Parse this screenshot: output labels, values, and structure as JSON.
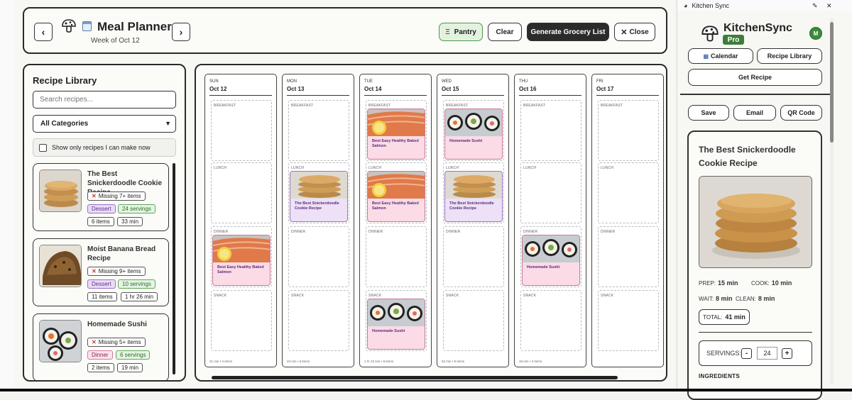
{
  "header": {
    "title": "Meal Planner",
    "week": "Week of Oct 12",
    "prev": "‹",
    "next": "›",
    "pantry": "Pantry",
    "clear": "Clear",
    "grocery": "Generate Grocery List",
    "close": "Close"
  },
  "library": {
    "title": "Recipe Library",
    "search_placeholder": "Search recipes...",
    "category": "All Categories",
    "only_label": "Show only recipes I can make now",
    "cards": [
      {
        "name": "The Best Snickerdoodle Cookie Recipe",
        "missing": "Missing 7+ items",
        "category": "Dessert",
        "servings": "24 servings",
        "items": "6 items",
        "time": "33 min"
      },
      {
        "name": "Moist Banana Bread Recipe",
        "missing": "Missing 9+ items",
        "category": "Dessert",
        "servings": "10 servings",
        "items": "11 items",
        "time": "1 hr 26 min"
      },
      {
        "name": "Homemade Sushi",
        "missing": "Missing 5+ items",
        "category": "Dinner",
        "servings": "6 servings",
        "items": "2 items",
        "time": "19 min"
      }
    ]
  },
  "calendar": {
    "slots": [
      "BREAKFAST",
      "LUNCH",
      "DINNER",
      "SNACK"
    ],
    "days": [
      {
        "name": "SUN",
        "date": "Oct 12",
        "footer": "31 min • 4 items",
        "meals": {
          "dinner": "Best Easy Healthy Baked Salmon"
        }
      },
      {
        "name": "MON",
        "date": "Oct 13",
        "footer": "33 min • 6 items",
        "meals": {
          "lunch": "The Best Snickerdoodle Cookie Recipe"
        }
      },
      {
        "name": "TUE",
        "date": "Oct 14",
        "footer": "1 hr 23 min • 8 items",
        "meals": {
          "breakfast": "Best Easy Healthy Baked Salmon",
          "lunch": "Best Easy Healthy Baked Salmon",
          "snack": "Homemade Sushi"
        }
      },
      {
        "name": "WED",
        "date": "Oct 15",
        "footer": "52 min • 8 items",
        "meals": {
          "breakfast": "Homemade Sushi",
          "lunch": "The Best Snickerdoodle Cookie Recipe"
        }
      },
      {
        "name": "THU",
        "date": "Oct 16",
        "footer": "19 min • 2 items",
        "meals": {
          "dinner": "Homemade Sushi"
        }
      },
      {
        "name": "FRI",
        "date": "Oct 17",
        "footer": "",
        "meals": {}
      }
    ]
  },
  "side": {
    "window_title": "Kitchen Sync",
    "brand": "KitchenSync",
    "pro": "Pro",
    "avatar": "M",
    "calendar_btn": "Calendar",
    "library_btn": "Recipe Library",
    "get_recipe": "Get Recipe",
    "save": "Save",
    "email": "Email",
    "qr": "QR Code",
    "recipe_title": "The Best Snickerdoodle Cookie Recipe",
    "prep_label": "PREP:",
    "prep": "15 min",
    "cook_label": "COOK:",
    "cook": "10 min",
    "wait_label": "WAIT:",
    "wait": "8 min",
    "clean_label": "CLEAN:",
    "clean": "8 min",
    "total_label": "TOTAL:",
    "total": "41 min",
    "servings_label": "SERVINGS:",
    "servings": "24",
    "minus": "-",
    "plus": "+",
    "ingredients": "INGREDIENTS"
  },
  "colors": {
    "pro": "#3d7d3a",
    "grocery_btn": "#2b2b2b",
    "pantry_btn": "#e3f2df"
  }
}
